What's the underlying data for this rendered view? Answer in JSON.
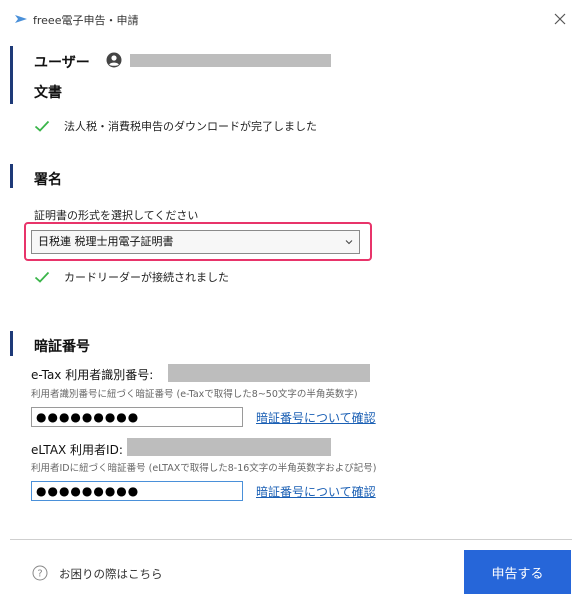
{
  "window": {
    "title": "freee電子申告・申請",
    "logo_icon": "freee-logo-icon",
    "close_icon": "close-icon"
  },
  "user": {
    "heading": "ユーザー",
    "avatar_icon": "user-circle-icon"
  },
  "document": {
    "heading": "文書",
    "status_icon": "check-icon",
    "status_text": "法人税・消費税申告のダウンロードが完了しました"
  },
  "signature": {
    "heading": "署名",
    "select_label": "証明書の形式を選択してください",
    "select_value": "日税連 税理士用電子証明書",
    "reader_status": "カードリーダーが接続されました"
  },
  "pin": {
    "heading": "暗証番号",
    "etax": {
      "label": "e-Tax 利用者識別番号:",
      "hint": "利用者識別番号に紐づく暗証番号 (e-Taxで取得した8~50文字の半角英数字)",
      "masked_value": "●●●●●●●●●",
      "link": "暗証番号について確認"
    },
    "eltax": {
      "label": "eLTAX 利用者ID:",
      "hint": "利用者IDに紐づく暗証番号 (eLTAXで取得した8-16文字の半角英数字および記号)",
      "masked_value": "●●●●●●●●●",
      "link": "暗証番号について確認"
    }
  },
  "footer": {
    "help_icon": "question-circle-icon",
    "help_text": "お困りの際はこちら",
    "submit_label": "申告する"
  },
  "colors": {
    "accent": "#2666d9",
    "highlight": "#e8346a",
    "check": "#3bb54a",
    "section_bar": "#1e3a78",
    "link": "#1a5fb4"
  }
}
